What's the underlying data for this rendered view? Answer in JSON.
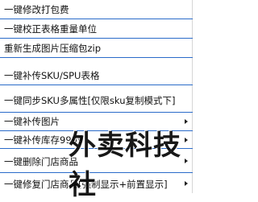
{
  "menu": {
    "items": [
      {
        "label": "一键修改打包费",
        "submenu": false
      },
      {
        "label": "一键校正表格重量单位",
        "submenu": false
      },
      {
        "label": "重新生成图片压缩包zip",
        "submenu": false
      },
      {
        "label": "一键补传SKU/SPU表格",
        "submenu": false
      },
      {
        "label": "一键同步SKU多属性[仅限sku复制模式下]",
        "submenu": false
      },
      {
        "label": "一键补传图片",
        "submenu": true
      },
      {
        "label": "一键补传库存9999",
        "submenu": true
      },
      {
        "label": "一键删除门店商品",
        "submenu": true
      },
      {
        "label": "一键修复门店商品[强制显示+前置显示]",
        "submenu": true
      }
    ]
  },
  "watermark": {
    "text": "外卖科技社"
  },
  "colors": {
    "divider": "#2a6bc9",
    "background": "#ffffff"
  },
  "icons": {
    "submenu": "chevron-right-icon"
  }
}
